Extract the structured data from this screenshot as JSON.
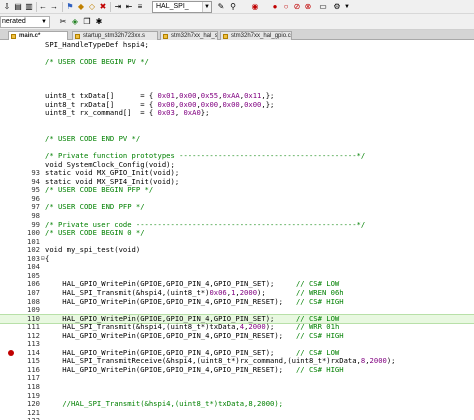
{
  "toolbar": {
    "file_combo": "HAL_SPI_"
  },
  "target": {
    "value": "nerated"
  },
  "tabs": [
    {
      "label": "main.c*",
      "active": true
    },
    {
      "label": "startup_stm32h723xx.s",
      "active": false
    },
    {
      "label": "stm32h7xx_hal_spi.c",
      "active": false
    },
    {
      "label": "stm32h7xx_hal_gpio.c",
      "active": false
    }
  ],
  "lines": [
    {
      "n": "",
      "t": "SPI_HandleTypeDef hspi4;"
    },
    {
      "n": "",
      "t": ""
    },
    {
      "n": "",
      "t": "/* USER CODE BEGIN PV */"
    },
    {
      "n": "",
      "t": ""
    },
    {
      "n": "",
      "t": ""
    },
    {
      "n": "",
      "t": ""
    },
    {
      "n": "",
      "t": "uint8_t txData[]      = { 0x01,0x00,0x55,0xAA,0x11,};"
    },
    {
      "n": "",
      "t": "uint8_t rxData[]      = { 0x00,0x00,0x00,0x00,0x00,};"
    },
    {
      "n": "",
      "t": "uint8_t rx_command[]  = { 0x03, 0xA0};"
    },
    {
      "n": "",
      "t": ""
    },
    {
      "n": "",
      "t": ""
    },
    {
      "n": "",
      "t": "/* USER CODE END PV */"
    },
    {
      "n": "",
      "t": ""
    },
    {
      "n": "",
      "t": "/* Private function prototypes -----------------------------------------*/"
    },
    {
      "n": "",
      "t": "void SystemClock_Config(void);"
    },
    {
      "n": "93",
      "t": "static void MX_GPIO_Init(void);"
    },
    {
      "n": "94",
      "t": "static void MX_SPI4_Init(void);"
    },
    {
      "n": "95",
      "t": "/* USER CODE BEGIN PFP */"
    },
    {
      "n": "96",
      "t": ""
    },
    {
      "n": "97",
      "t": "/* USER CODE END PFP */"
    },
    {
      "n": "98",
      "t": ""
    },
    {
      "n": "99",
      "t": "/* Private user code ---------------------------------------------------*/"
    },
    {
      "n": "100",
      "t": "/* USER CODE BEGIN 0 */"
    },
    {
      "n": "101",
      "t": ""
    },
    {
      "n": "102",
      "t": "void my_spi_test(void)"
    },
    {
      "n": "103",
      "t": "{"
    },
    {
      "n": "104",
      "t": ""
    },
    {
      "n": "105",
      "t": ""
    },
    {
      "n": "106",
      "t": "    HAL_GPIO_WritePin(GPIOE,GPIO_PIN_4,GPIO_PIN_SET);     // CS# LOW"
    },
    {
      "n": "107",
      "t": "    HAL_SPI_Transmit(&hspi4,(uint8_t*)0x06,1,2000);       // WREN 06h"
    },
    {
      "n": "108",
      "t": "    HAL_GPIO_WritePin(GPIOE,GPIO_PIN_4,GPIO_PIN_RESET);   // CS# HIGH"
    },
    {
      "n": "109",
      "t": ""
    },
    {
      "n": "110",
      "t": "    HAL_GPIO_WritePin(GPIOE,GPIO_PIN_4,GPIO_PIN_SET);     // CS# LOW"
    },
    {
      "n": "111",
      "t": "    HAL_SPI_Transmit(&hspi4,(uint8_t*)txData,4,2000);     // WRR 01h"
    },
    {
      "n": "112",
      "t": "    HAL_GPIO_WritePin(GPIOE,GPIO_PIN_4,GPIO_PIN_RESET);   // CS# HIGH"
    },
    {
      "n": "113",
      "t": ""
    },
    {
      "n": "114",
      "t": "    HAL_GPIO_WritePin(GPIOE,GPIO_PIN_4,GPIO_PIN_SET);     // CS# LOW"
    },
    {
      "n": "115",
      "t": "    HAL_SPI_TransmitReceive(&hspi4,(uint8_t*)rx_command,(uint8_t*)rxData,8,2000);"
    },
    {
      "n": "116",
      "t": "    HAL_GPIO_WritePin(GPIOE,GPIO_PIN_4,GPIO_PIN_RESET);   // CS# HIGH"
    },
    {
      "n": "117",
      "t": ""
    },
    {
      "n": "118",
      "t": ""
    },
    {
      "n": "119",
      "t": ""
    },
    {
      "n": "120",
      "t": "    //HAL_SPI_Transmit(&hspi4,(uint8_t*)txData,8,2000);"
    },
    {
      "n": "121",
      "t": ""
    },
    {
      "n": "122",
      "t": ""
    }
  ],
  "highlighted_line": "110",
  "breakpoint_line": "114",
  "colors": {
    "comment": "#008000",
    "number": "#800080",
    "breakpoint": "#c00000",
    "highlight": "#e8f8e0"
  }
}
